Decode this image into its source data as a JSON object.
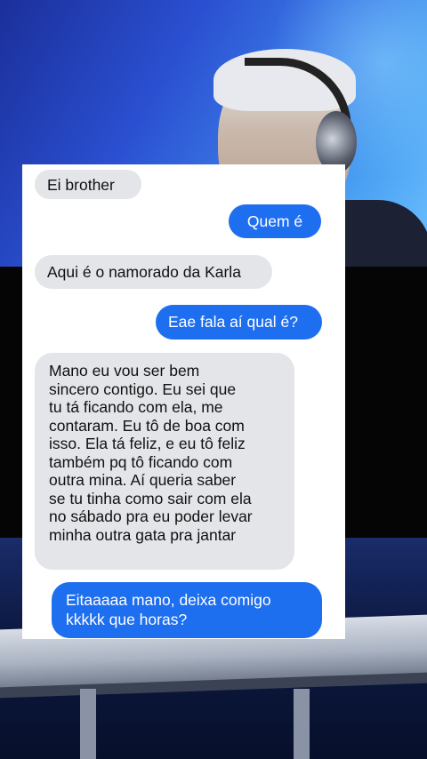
{
  "chat": {
    "messages": [
      {
        "side": "incoming",
        "text": "Ei brother"
      },
      {
        "side": "outgoing",
        "text": "Quem é"
      },
      {
        "side": "incoming",
        "text": "Aqui é o namorado da Karla"
      },
      {
        "side": "outgoing",
        "text": "Eae fala aí qual é?"
      },
      {
        "side": "incoming",
        "lines": [
          "Mano eu vou ser bem",
          "sincero contigo. Eu sei que",
          "tu tá ficando com ela, me",
          "contaram. Eu tô de boa com",
          "isso. Ela tá feliz, e eu tô feliz",
          "também pq tô ficando com",
          "outra mina. Aí queria saber",
          "se tu tinha como sair com ela",
          "no sábado pra eu poder levar",
          "minha outra gata pra jantar"
        ]
      },
      {
        "side": "outgoing",
        "lines": [
          "Eitaaaaa mano, deixa comigo",
          "kkkkk que horas?"
        ]
      }
    ]
  },
  "colors": {
    "incoming_bubble": "#e4e5e9",
    "outgoing_bubble": "#1e6ef0",
    "card_background": "#ffffff"
  }
}
